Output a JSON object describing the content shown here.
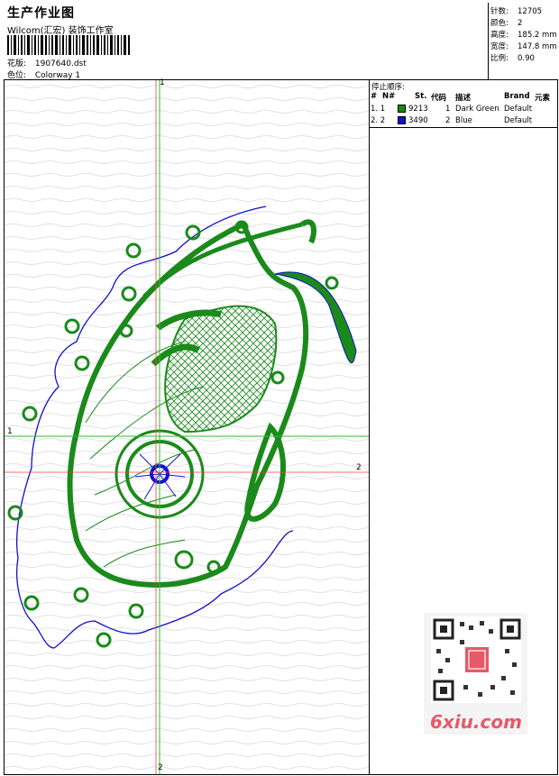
{
  "header": {
    "title": "生产作业图",
    "company": "Wilcom(汇宏) 装饰工作室",
    "design_label": "花版:",
    "design_value": "1907640.dst",
    "colorway_label": "色位:",
    "colorway_value": "Colorway 1"
  },
  "stats": {
    "stitches_label": "针数:",
    "stitches_value": "12705",
    "colors_label": "颜色:",
    "colors_value": "2",
    "height_label": "高度:",
    "height_value": "185.2 mm",
    "width_label": "宽度:",
    "width_value": "147.8 mm",
    "scale_label": "比例:",
    "scale_value": "0.90"
  },
  "color_panel": {
    "title": "停止顺序:",
    "columns": [
      "#",
      "N#",
      "St.",
      "代码",
      "描述",
      "Brand",
      "元素"
    ],
    "rows": [
      {
        "index": "1. 1",
        "color": "#118811",
        "code": "9213",
        "st": "1",
        "desc": "Dark Green",
        "brand": "Default"
      },
      {
        "index": "2. 2",
        "color": "#1111cc",
        "code": "3490",
        "st": "2",
        "desc": "Blue",
        "brand": "Default"
      }
    ]
  },
  "axes": {
    "top_label": "1",
    "bottom_label": "2",
    "left_label": "1",
    "right_label": "2"
  },
  "watermark": {
    "text": "6xiu.com"
  }
}
